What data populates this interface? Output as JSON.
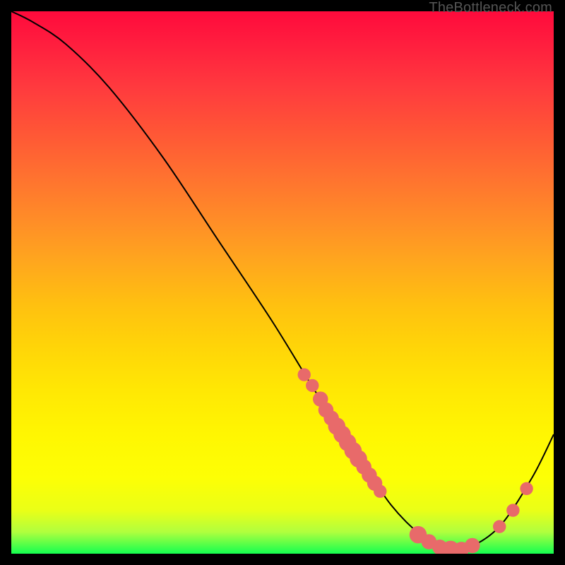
{
  "watermark": "TheBottleneck.com",
  "chart_data": {
    "type": "line",
    "title": "",
    "xlabel": "",
    "ylabel": "",
    "xlim": [
      0,
      100
    ],
    "ylim": [
      0,
      100
    ],
    "series": [
      {
        "name": "curve",
        "x": [
          0,
          4,
          10,
          18,
          28,
          38,
          48,
          56,
          60,
          64,
          70,
          76,
          80,
          84,
          90,
          96,
          100
        ],
        "y": [
          100,
          98,
          94,
          86,
          73,
          58,
          43,
          30,
          24,
          18,
          9,
          3,
          1,
          1,
          5,
          14,
          22
        ]
      }
    ],
    "markers": [
      {
        "x": 54,
        "y": 33,
        "r": 1.2
      },
      {
        "x": 55.5,
        "y": 31,
        "r": 1.2
      },
      {
        "x": 57,
        "y": 28.5,
        "r": 1.4
      },
      {
        "x": 58,
        "y": 26.5,
        "r": 1.4
      },
      {
        "x": 59,
        "y": 25,
        "r": 1.4
      },
      {
        "x": 60,
        "y": 23.5,
        "r": 1.6
      },
      {
        "x": 61,
        "y": 22,
        "r": 1.6
      },
      {
        "x": 62,
        "y": 20.5,
        "r": 1.6
      },
      {
        "x": 63,
        "y": 19,
        "r": 1.6
      },
      {
        "x": 64,
        "y": 17.5,
        "r": 1.6
      },
      {
        "x": 65,
        "y": 16,
        "r": 1.4
      },
      {
        "x": 66,
        "y": 14.5,
        "r": 1.4
      },
      {
        "x": 67,
        "y": 13,
        "r": 1.4
      },
      {
        "x": 68,
        "y": 11.5,
        "r": 1.2
      },
      {
        "x": 75,
        "y": 3.5,
        "r": 1.6
      },
      {
        "x": 77,
        "y": 2.2,
        "r": 1.4
      },
      {
        "x": 79,
        "y": 1.2,
        "r": 1.4
      },
      {
        "x": 81,
        "y": 0.8,
        "r": 1.6
      },
      {
        "x": 83,
        "y": 0.8,
        "r": 1.4
      },
      {
        "x": 85,
        "y": 1.5,
        "r": 1.4
      },
      {
        "x": 90,
        "y": 5,
        "r": 1.2
      },
      {
        "x": 92.5,
        "y": 8,
        "r": 1.2
      },
      {
        "x": 95,
        "y": 12,
        "r": 1.2
      }
    ],
    "curve_color": "#000000",
    "marker_color": "#e86a6a"
  }
}
